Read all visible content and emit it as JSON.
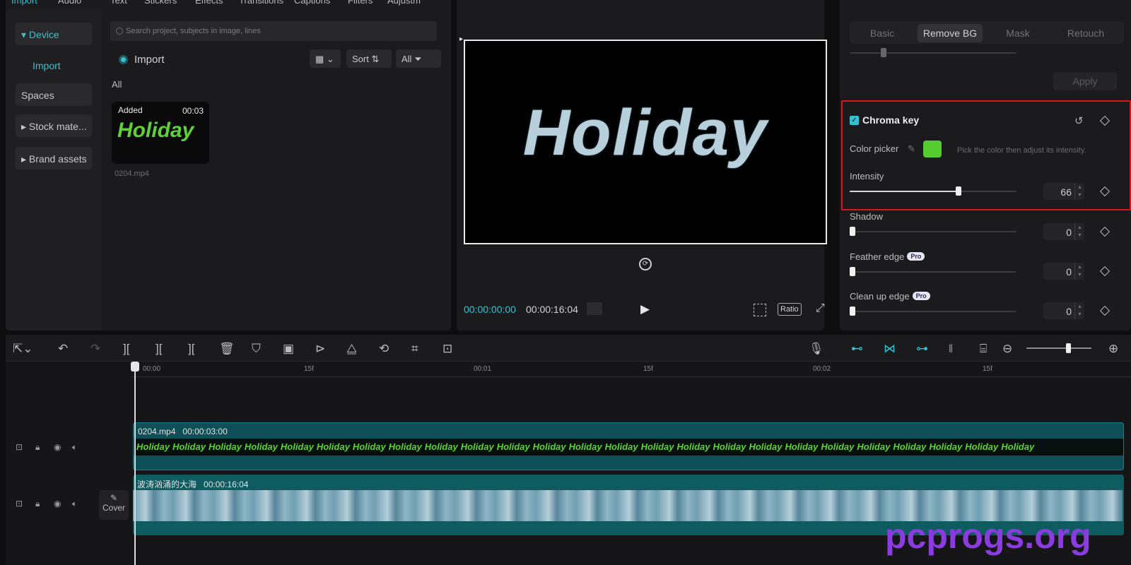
{
  "top_nav": {
    "tabs": [
      "Import",
      "Audio",
      "Text",
      "Stickers",
      "Effects",
      "Transitions",
      "Captions",
      "Filters",
      "Adjustm"
    ],
    "active": "Import"
  },
  "sidebar": {
    "items": [
      "Device",
      "Import",
      "Spaces",
      "Stock mate...",
      "Brand assets"
    ]
  },
  "media": {
    "search_placeholder": "Search project, subjects in image, lines",
    "import_label": "Import",
    "sort_label": "Sort",
    "all_filter_label": "All",
    "section_label": "All",
    "card": {
      "badge": "Added",
      "duration": "00:03",
      "thumb_text": "Holiday",
      "filename": "0204.mp4"
    }
  },
  "viewer": {
    "preview_text": "Holiday",
    "current_time": "00:00:00:00",
    "total_time": "00:00:16:04",
    "ratio_label": "Ratio"
  },
  "inspector": {
    "tabs": [
      "Basic",
      "Remove BG",
      "Mask",
      "Retouch"
    ],
    "active_tab": "Remove BG",
    "apply_label": "Apply",
    "chroma_key": {
      "label": "Chroma key",
      "checked": true,
      "color_picker_label": "Color picker",
      "picked_color": "#55cc2f",
      "hint": "Pick the color then adjust its intensity.",
      "intensity_label": "Intensity",
      "intensity_value": "66"
    },
    "shadow": {
      "label": "Shadow",
      "value": "0"
    },
    "feather_edge": {
      "label": "Feather edge",
      "badge": "Pro",
      "value": "0"
    },
    "clean_up_edge": {
      "label": "Clean up edge",
      "badge": "Pro",
      "value": "0"
    }
  },
  "timeline": {
    "ruler_labels": [
      "00:00",
      "15f",
      "00:01",
      "15f",
      "00:02",
      "15f"
    ],
    "tracks": [
      {
        "name": "0204.mp4",
        "duration": "00:00:03:00",
        "strip_word": "Holiday",
        "repeat": 25
      },
      {
        "name": "波涛汹涌的大海",
        "duration": "00:00:16:04"
      }
    ],
    "cover_label": "Cover"
  },
  "watermark": "pcprogs.org",
  "colors": {
    "accent": "#35c2cf",
    "highlight_border": "#d8161b",
    "clip_teal": "#0f4f57",
    "watermark": "#8a3ce0"
  }
}
